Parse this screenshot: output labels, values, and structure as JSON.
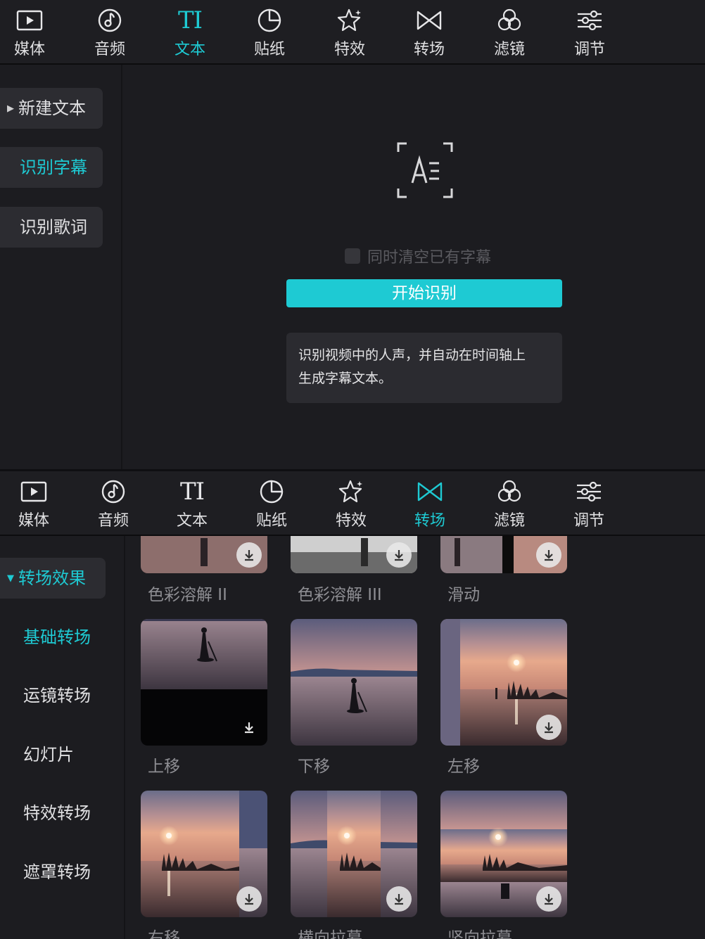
{
  "toolbar": {
    "items": [
      {
        "label": "媒体",
        "icon": "media-play-icon"
      },
      {
        "label": "音频",
        "icon": "music-note-icon"
      },
      {
        "label": "文本",
        "icon": "text-ti-icon",
        "glyph": "TI"
      },
      {
        "label": "贴纸",
        "icon": "sticker-icon"
      },
      {
        "label": "特效",
        "icon": "sparkle-star-icon"
      },
      {
        "label": "转场",
        "icon": "bowtie-transition-icon"
      },
      {
        "label": "滤镜",
        "icon": "filter-circles-icon"
      },
      {
        "label": "调节",
        "icon": "sliders-adjust-icon"
      }
    ]
  },
  "top": {
    "active_tab": "文本",
    "sidebar": [
      "新建文本",
      "识别字幕",
      "识别歌词"
    ],
    "selected_sidebar": "识别字幕",
    "checkbox_label": "同时清空已有字幕",
    "checkbox_checked": false,
    "start_button": "开始识别",
    "tip_line1": "识别视频中的人声，并自动在时间轴上",
    "tip_line2": "生成字幕文本。"
  },
  "bottom": {
    "active_tab": "转场",
    "sidebar_group": "转场效果",
    "sidebar": [
      "基础转场",
      "运镜转场",
      "幻灯片",
      "特效转场",
      "遮罩转场"
    ],
    "selected_sidebar": "基础转场",
    "thumbnails_row1": [
      "色彩溶解 II",
      "色彩溶解 III",
      "滑动"
    ],
    "thumbnails_row2": [
      "上移",
      "下移",
      "左移"
    ],
    "thumbnails_row3": [
      "右移",
      "横向拉幕",
      "竖向拉幕"
    ]
  },
  "colors": {
    "accent": "#1ecad3",
    "panel_bg": "#1c1c20",
    "pill_bg": "#2c2c31",
    "caption": "#8e8e93"
  }
}
